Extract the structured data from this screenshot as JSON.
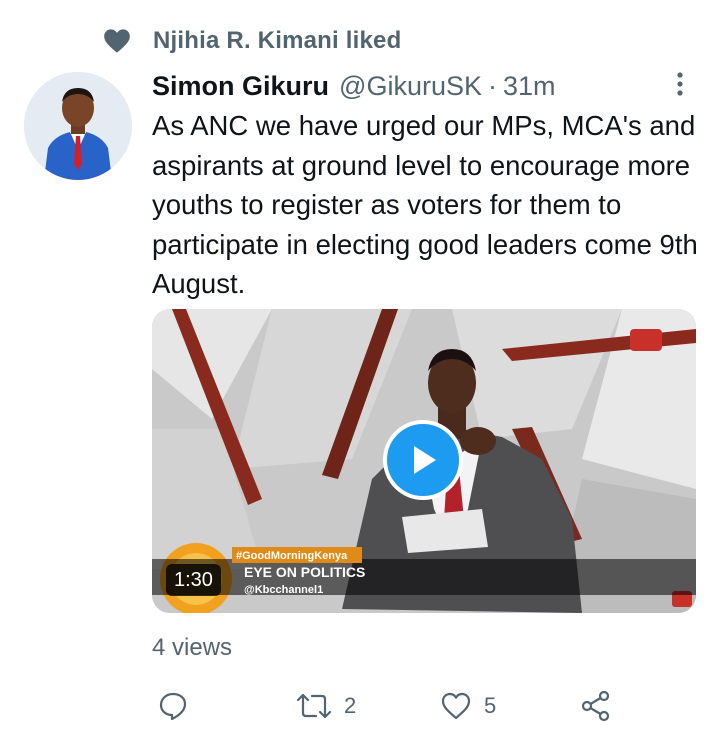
{
  "social_context": {
    "text": "Njihia R. Kimani liked",
    "icon": "heart-icon"
  },
  "tweet": {
    "author_name": "Simon Gikuru",
    "handle": "@GikuruSK",
    "separator": "·",
    "time": "31m",
    "text": "As ANC we have urged our MPs, MCA's and aspirants at ground level to encourage more youths to register as voters for them to participate in electing good leaders come 9th August.",
    "media": {
      "duration": "1:30",
      "overlay_hashtag": "#GoodMorningKenya",
      "overlay_title": "EYE ON POLITICS",
      "overlay_handle": "@Kbcchannel1"
    },
    "views": "4 views"
  },
  "actions": {
    "reply": {
      "icon": "reply-icon"
    },
    "retweet": {
      "icon": "retweet-icon",
      "count": "2"
    },
    "like": {
      "icon": "like-icon",
      "count": "5"
    },
    "share": {
      "icon": "share-icon"
    }
  },
  "colors": {
    "accent": "#1d9bf0",
    "secondary_text": "#536471",
    "primary_text": "#0f1419"
  }
}
